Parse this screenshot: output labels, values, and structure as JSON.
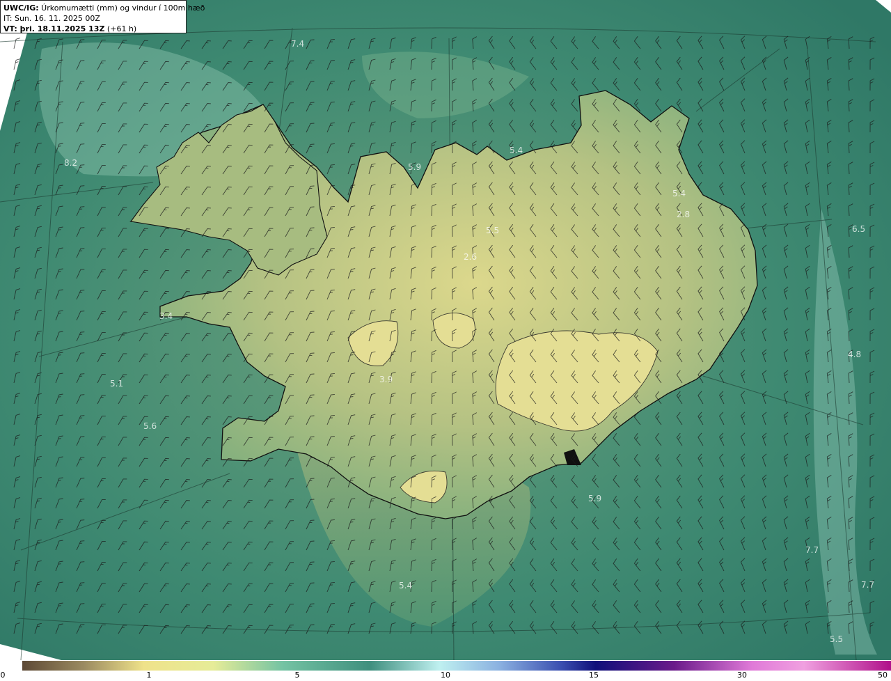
{
  "header": {
    "line1_bold": "UWC/IG:",
    "line1_text": " Úrkomumætti (mm) og vindur í 100m hæð",
    "line2": "IT: Sun. 16. 11. 2025 00Z",
    "line3_bold": "VT: þri. 18.11.2025 13Z",
    "line3_text": " (+61 h)"
  },
  "map_labels": [
    {
      "text": "7.4"
    },
    {
      "text": "8.2"
    },
    {
      "text": "5.9"
    },
    {
      "text": "5.4"
    },
    {
      "text": "5.4"
    },
    {
      "text": "2.8"
    },
    {
      "text": "5.5"
    },
    {
      "text": "2.6"
    },
    {
      "text": "6.5"
    },
    {
      "text": "3.4"
    },
    {
      "text": "3.9"
    },
    {
      "text": "5.1"
    },
    {
      "text": "5.6"
    },
    {
      "text": "4.8"
    },
    {
      "text": "5.9"
    },
    {
      "text": "7.7"
    },
    {
      "text": "5.4"
    },
    {
      "text": "7.7"
    },
    {
      "text": "5.5"
    }
  ],
  "colorbar": {
    "ticks": [
      "0",
      "1",
      "5",
      "10",
      "15",
      "30",
      "50"
    ],
    "colors": [
      "#5e4a36",
      "#9a8a60",
      "#efe28a",
      "#e6ec98",
      "#74c3a3",
      "#3f8f7e",
      "#bff0f0",
      "#8ab0e0",
      "#3b4fb0",
      "#10107a",
      "#6a1a8a",
      "#e07ad8",
      "#f0a0e0",
      "#b0108a"
    ]
  },
  "style": {
    "sea_color": "#3e8a72",
    "land_color": "#b9c685",
    "highland_color": "#e3dd90"
  }
}
